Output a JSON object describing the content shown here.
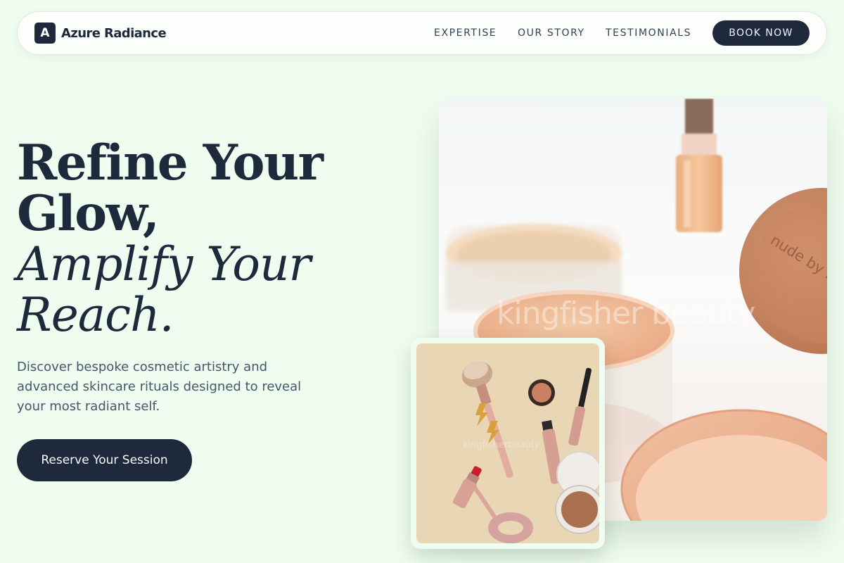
{
  "brand": {
    "mark": "A",
    "name": "Azure Radiance"
  },
  "nav": {
    "links": [
      "EXPERTISE",
      "OUR STORY",
      "TESTIMONIALS"
    ],
    "book_label": "BOOK NOW"
  },
  "hero": {
    "line1": "Refine Your",
    "line2": "Glow,",
    "line3": "Amplify Your",
    "line4": "Reach.",
    "description": "Discover bespoke cosmetic artistry and advanced skincare rituals designed to reveal your most radiant self.",
    "cta_label": "Reserve Your Session"
  },
  "images": {
    "main_watermark": "kingfisher beauty",
    "jar_brand": "nude by na",
    "inset_watermark": "kingfisherbeauty"
  },
  "colors": {
    "background": "#effdf0",
    "primary": "#1e293b",
    "text_muted": "#475569"
  }
}
